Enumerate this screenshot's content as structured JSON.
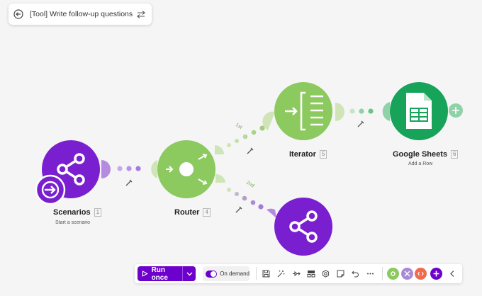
{
  "header": {
    "title": "[Tool] Write follow-up questions",
    "back_icon": "arrow-left-circle-icon",
    "swap_icon": "swap-arrows-icon"
  },
  "colors": {
    "purple": "#7a1fd0",
    "green": "#8cc95f",
    "sheets_green": "#17a35a",
    "canvas": "#f5f5f5",
    "run_button": "#6d00cc"
  },
  "nodes": {
    "scenarios": {
      "label": "Scenarios",
      "number": "1",
      "subtitle": "Start a scenario",
      "icon": "share-icon"
    },
    "router": {
      "label": "Router",
      "number": "4",
      "icon": "router-icon"
    },
    "iterator": {
      "label": "Iterator",
      "number": "5",
      "icon": "iterator-icon"
    },
    "google_sheets": {
      "label": "Google Sheets",
      "number": "6",
      "subtitle": "Add a Row",
      "icon": "spreadsheet-icon"
    },
    "unnamed_share": {
      "icon": "share-icon"
    }
  },
  "routes": {
    "first": "1st",
    "second": "2nd"
  },
  "toolbar": {
    "run_label": "Run once",
    "schedule_label": "On demand",
    "tools": [
      "save-icon",
      "magic-wand-icon",
      "explain-flow-icon",
      "layout-icon",
      "settings-icon",
      "notes-icon",
      "undo-icon",
      "more-icon"
    ],
    "end_icons": [
      "tools-icon",
      "flow-control-icon",
      "text-parser-icon",
      "add-icon",
      "collapse-icon"
    ]
  }
}
